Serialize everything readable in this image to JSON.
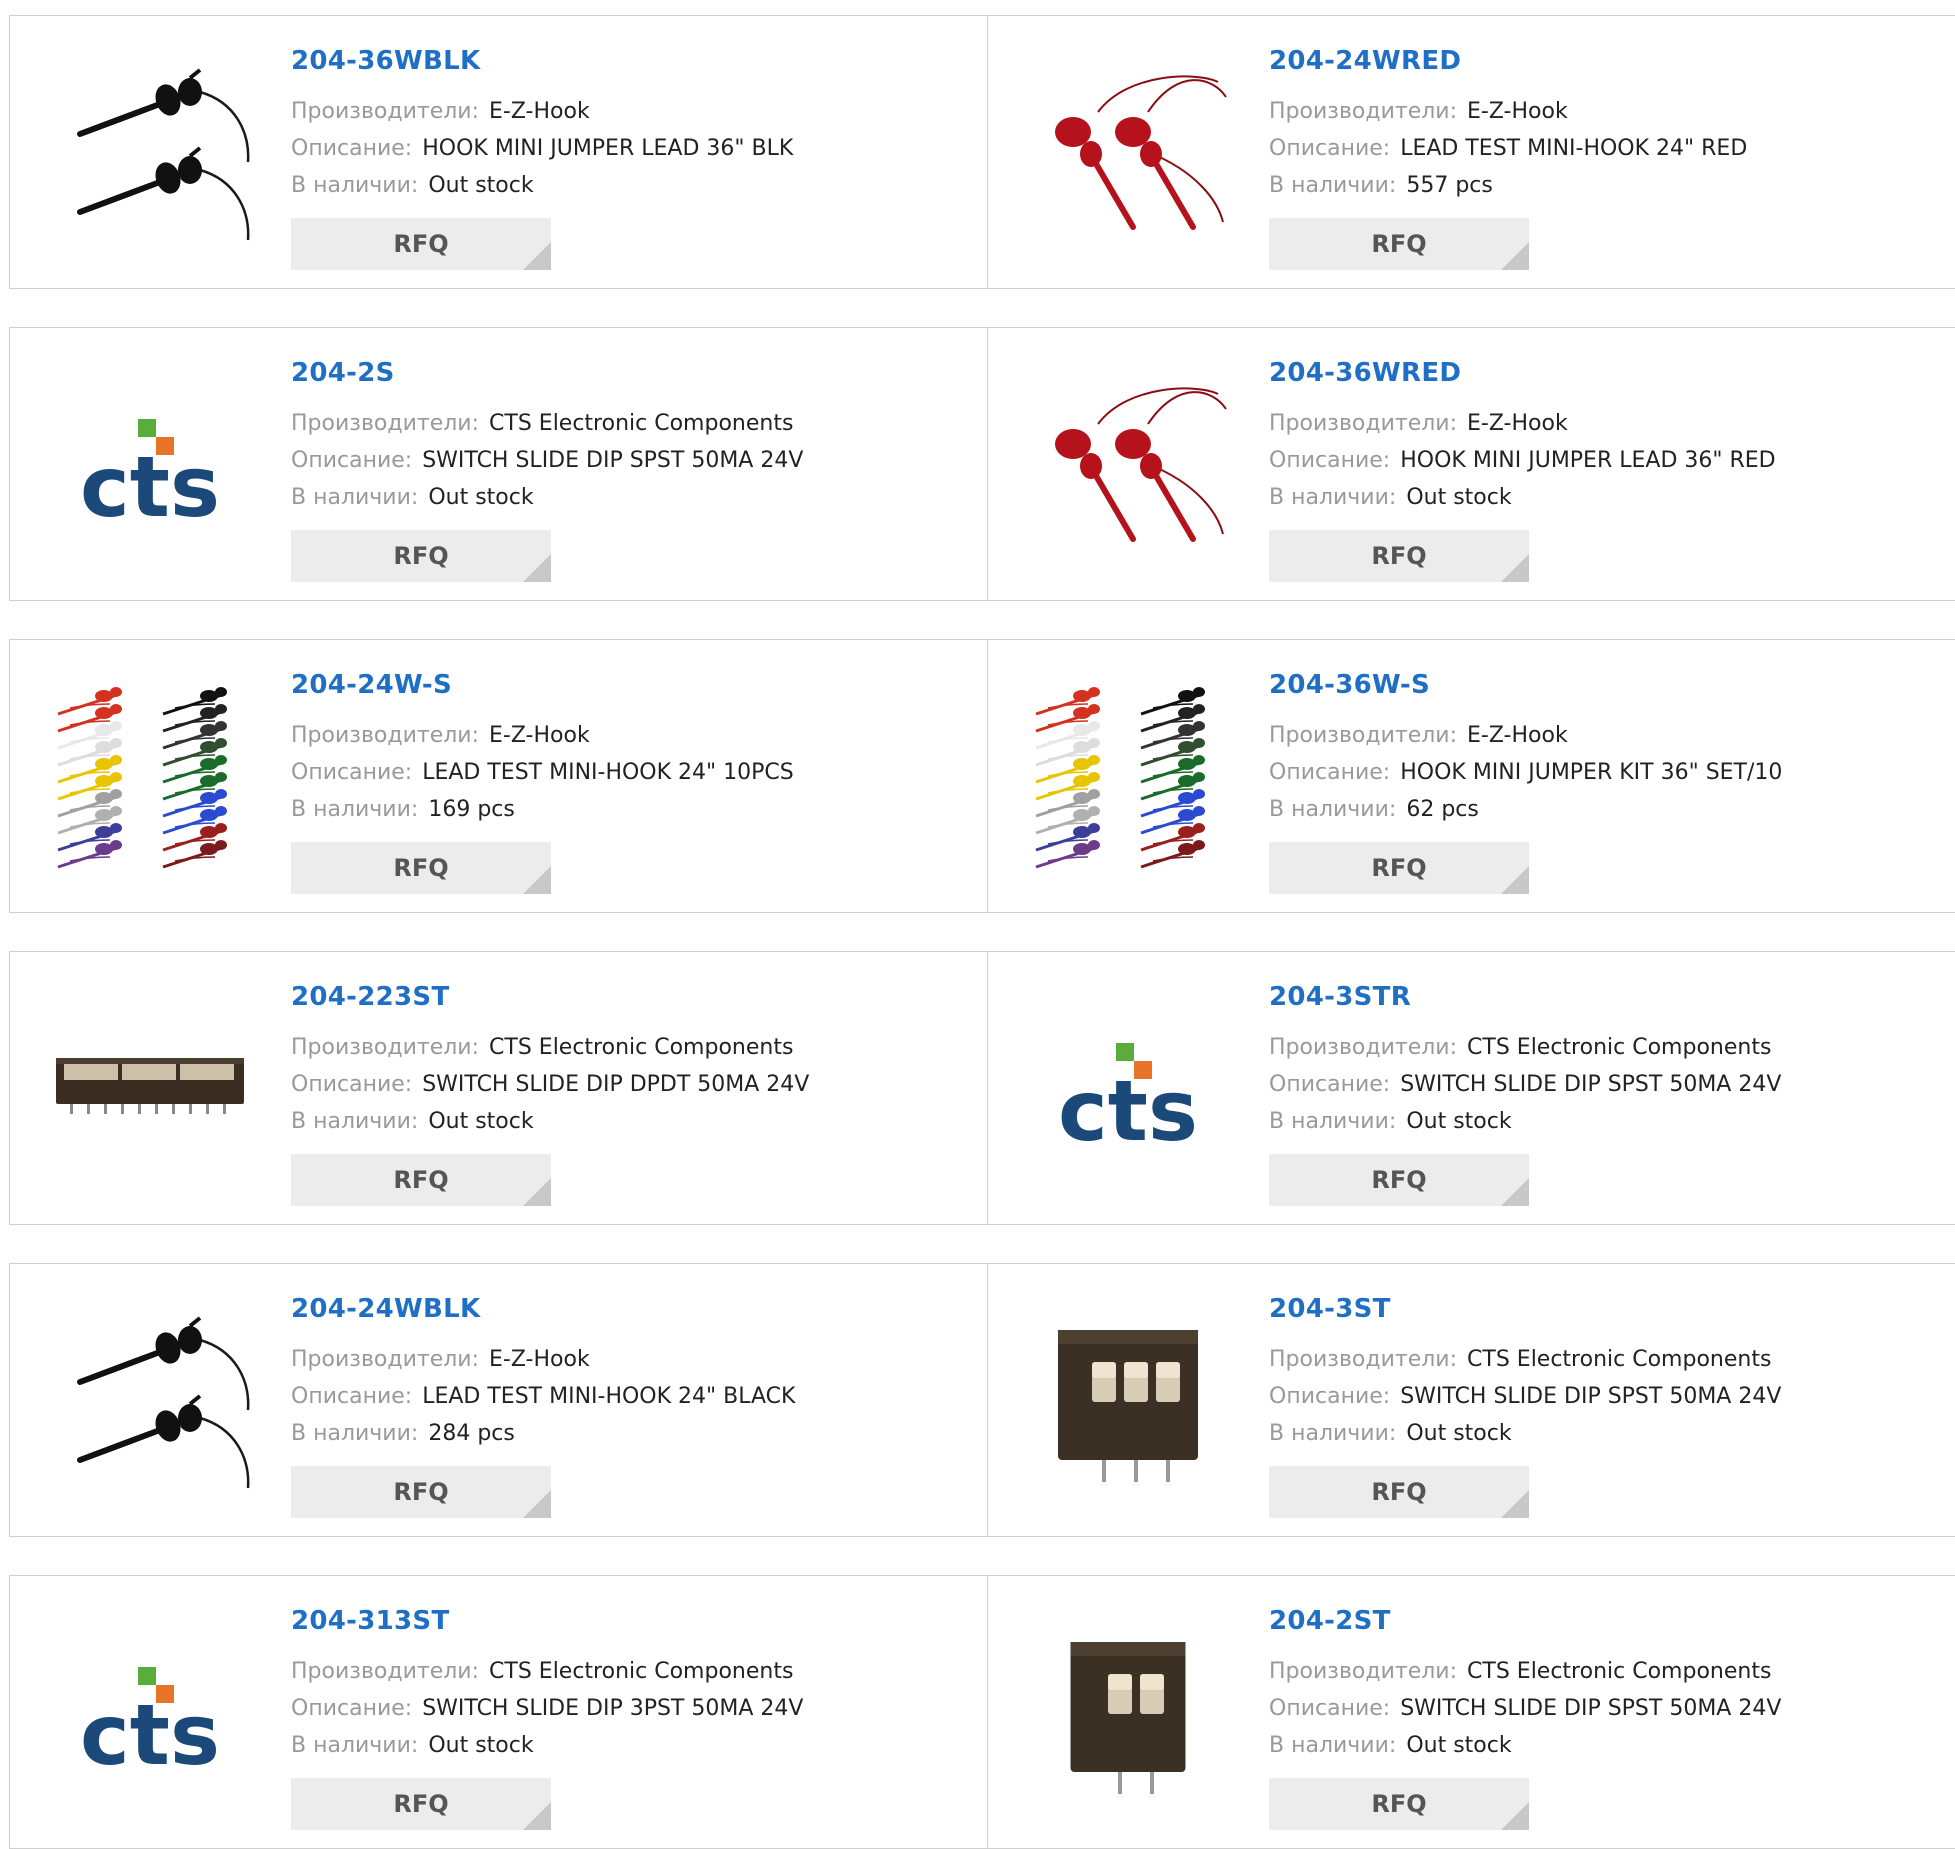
{
  "labels": {
    "manufacturer": "Производители:",
    "description": "Описание:",
    "stock": "В наличии:",
    "rfq": "RFQ"
  },
  "colors": {
    "part_link": "#1f6fc5",
    "cts_blue": "#1b4a7a",
    "cts_green": "#5aad3b",
    "cts_orange": "#e8742a"
  },
  "products": [
    {
      "part": "204-36WBLK",
      "manufacturer": "E-Z-Hook",
      "description": "HOOK MINI JUMPER LEAD 36\" BLK",
      "stock": "Out stock",
      "image": "black-hooks"
    },
    {
      "part": "204-24WRED",
      "manufacturer": "E-Z-Hook",
      "description": "LEAD TEST MINI-HOOK 24\" RED",
      "stock": "557 pcs",
      "image": "red-hooks"
    },
    {
      "part": "204-2S",
      "manufacturer": "CTS Electronic Components",
      "description": "SWITCH SLIDE DIP SPST 50MA 24V",
      "stock": "Out stock",
      "image": "cts-logo"
    },
    {
      "part": "204-36WRED",
      "manufacturer": "E-Z-Hook",
      "description": "HOOK MINI JUMPER LEAD 36\" RED",
      "stock": "Out stock",
      "image": "red-hooks"
    },
    {
      "part": "204-24W-S",
      "manufacturer": "E-Z-Hook",
      "description": "LEAD TEST MINI-HOOK 24\" 10PCS",
      "stock": "169 pcs",
      "image": "multi-hooks"
    },
    {
      "part": "204-36W-S",
      "manufacturer": "E-Z-Hook",
      "description": "HOOK MINI JUMPER KIT 36\" SET/10",
      "stock": "62 pcs",
      "image": "multi-hooks"
    },
    {
      "part": "204-223ST",
      "manufacturer": "CTS Electronic Components",
      "description": "SWITCH SLIDE DIP DPDT 50MA 24V",
      "stock": "Out stock",
      "image": "dip-long"
    },
    {
      "part": "204-3STR",
      "manufacturer": "CTS Electronic Components",
      "description": "SWITCH SLIDE DIP SPST 50MA 24V",
      "stock": "Out stock",
      "image": "cts-logo"
    },
    {
      "part": "204-24WBLK",
      "manufacturer": "E-Z-Hook",
      "description": "LEAD TEST MINI-HOOK 24\" BLACK",
      "stock": "284 pcs",
      "image": "black-hooks"
    },
    {
      "part": "204-3ST",
      "manufacturer": "CTS Electronic Components",
      "description": "SWITCH SLIDE DIP SPST 50MA 24V",
      "stock": "Out stock",
      "image": "dip-3"
    },
    {
      "part": "204-313ST",
      "manufacturer": "CTS Electronic Components",
      "description": "SWITCH SLIDE DIP 3PST 50MA 24V",
      "stock": "Out stock",
      "image": "cts-logo"
    },
    {
      "part": "204-2ST",
      "manufacturer": "CTS Electronic Components",
      "description": "SWITCH SLIDE DIP SPST 50MA 24V",
      "stock": "Out stock",
      "image": "dip-2"
    }
  ]
}
